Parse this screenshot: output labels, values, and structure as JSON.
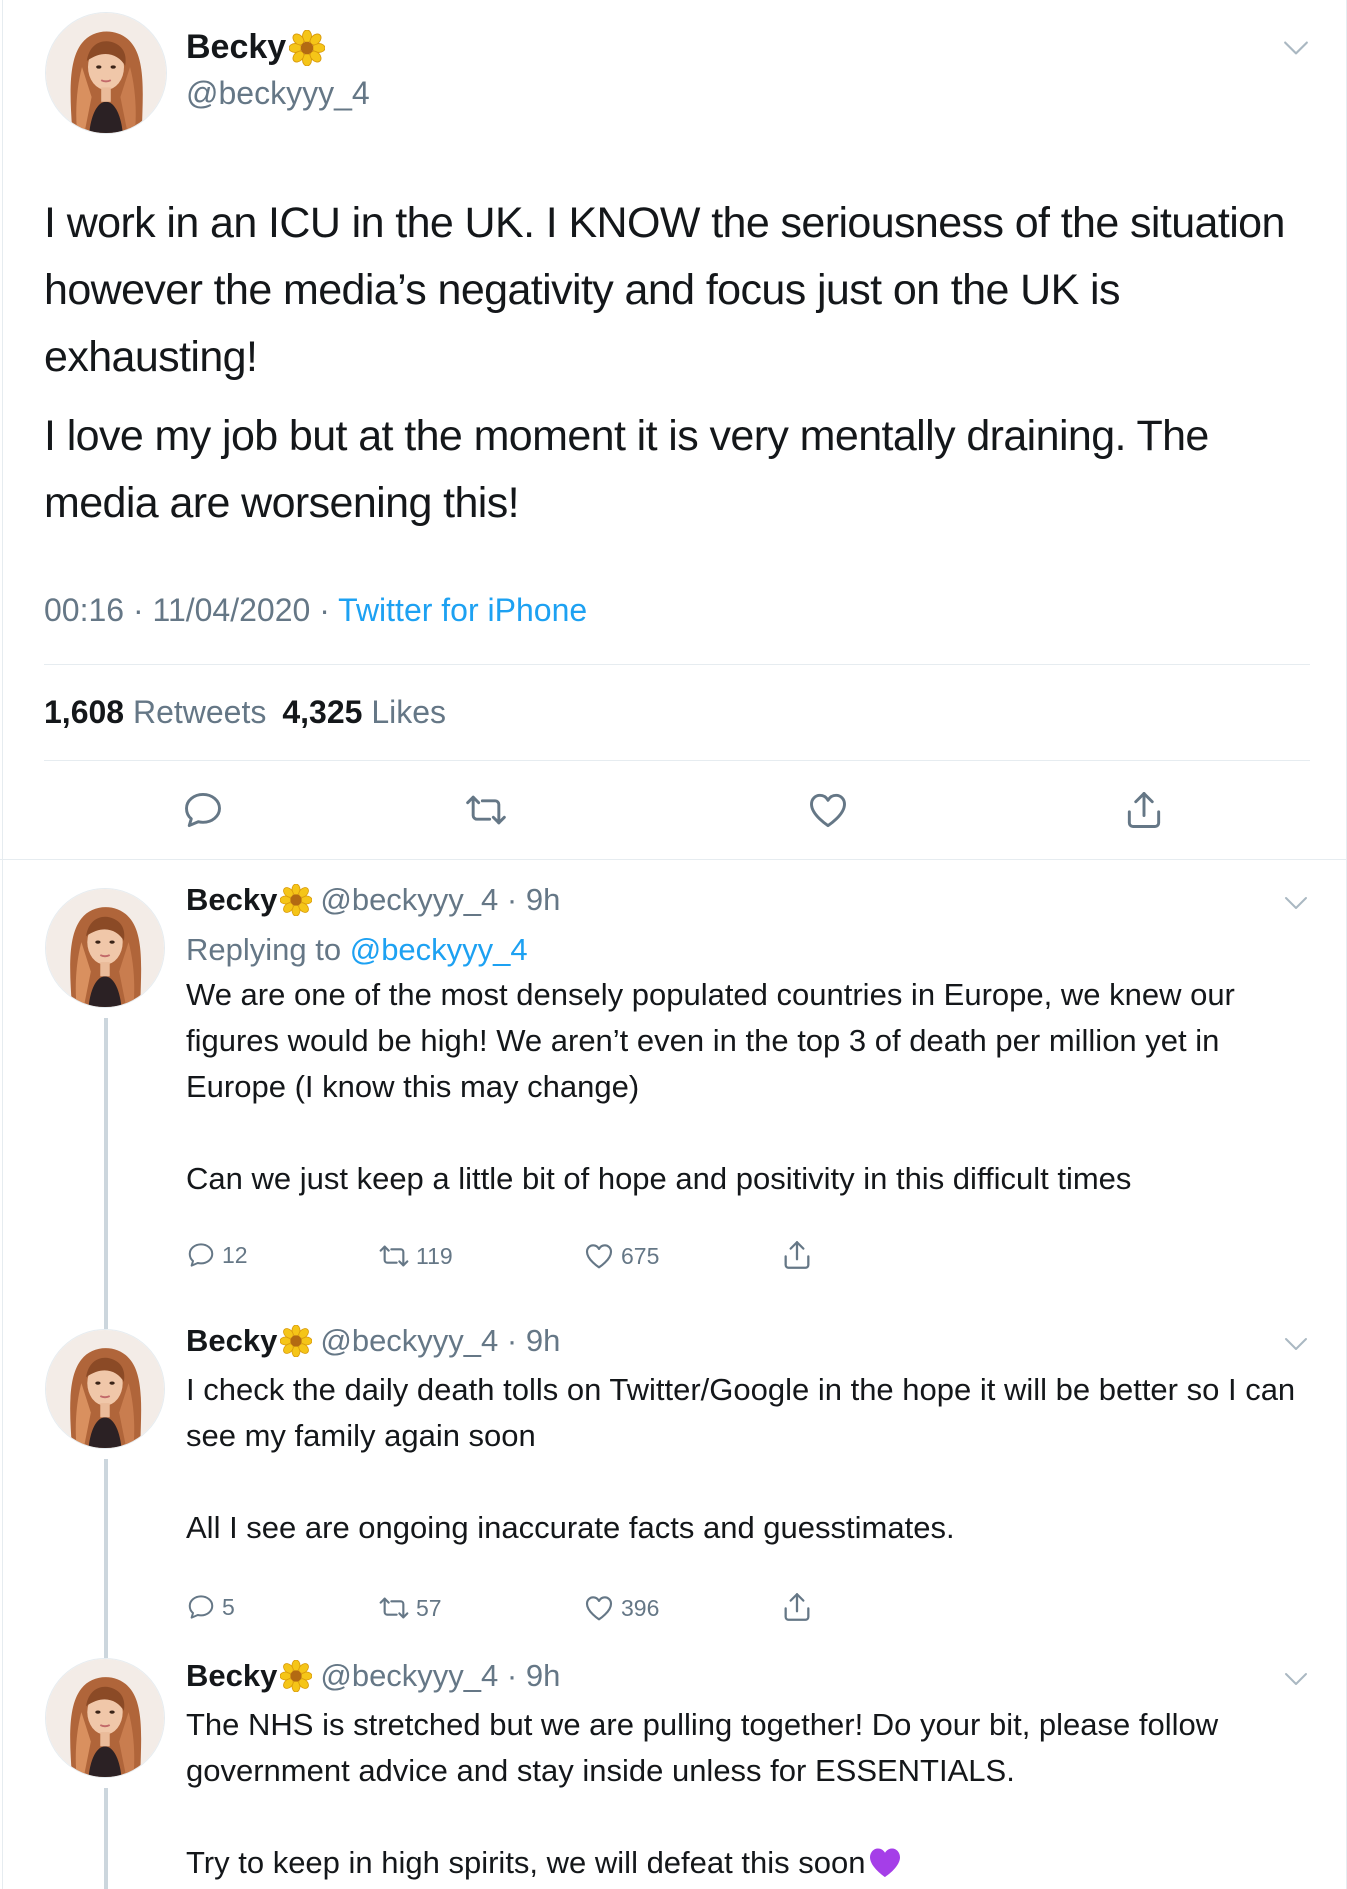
{
  "main": {
    "name": "Becky",
    "handle": "@beckyyy_4",
    "text1": "I work in an ICU in the UK. I KNOW the seriousness of the situation however the media’s negativity and focus just on the UK is exhausting!",
    "text2": "I love my job but at the moment it is very mentally draining. The media are worsening this!",
    "time": "00:16 · 11/04/2020 · ",
    "source": "Twitter for iPhone",
    "retweets": "1,608",
    "retweets_label": "Retweets",
    "likes": "4,325",
    "likes_label": "Likes"
  },
  "replies": [
    {
      "name": "Becky",
      "handle": "@beckyyy_4 · 9h",
      "replying_prefix": "Replying to ",
      "replying_to": "@beckyyy_4",
      "text": "We are one of the most densely populated countries in Europe, we knew our figures would be high! We aren’t even in the top 3 of death per million yet in Europe (I know this may change)\n\nCan we just keep a little bit of hope and positivity in this difficult times",
      "replies": "12",
      "retweets": "119",
      "likes": "675"
    },
    {
      "name": "Becky",
      "handle": "@beckyyy_4 · 9h",
      "text": "I check the daily death tolls on Twitter/Google in the hope it will be better so I can see my family again soon\n\nAll I see are ongoing inaccurate facts and guesstimates.",
      "replies": "5",
      "retweets": "57",
      "likes": "396"
    },
    {
      "name": "Becky",
      "handle": "@beckyyy_4 · 9h",
      "text": "The NHS is stretched but we are pulling together! Do your bit, please follow government advice and stay inside unless for ESSENTIALS.\n\nTry to keep in high spirits, we will defeat this soon",
      "emoji": "purple-heart"
    }
  ],
  "colors": {
    "accent": "#1da1f2",
    "secondary_text": "#657786",
    "divider": "#e6ecf0",
    "thread_line": "#ccd6dd",
    "heart_emoji": "#a53ee8",
    "flower_petals": "#f5c518"
  }
}
